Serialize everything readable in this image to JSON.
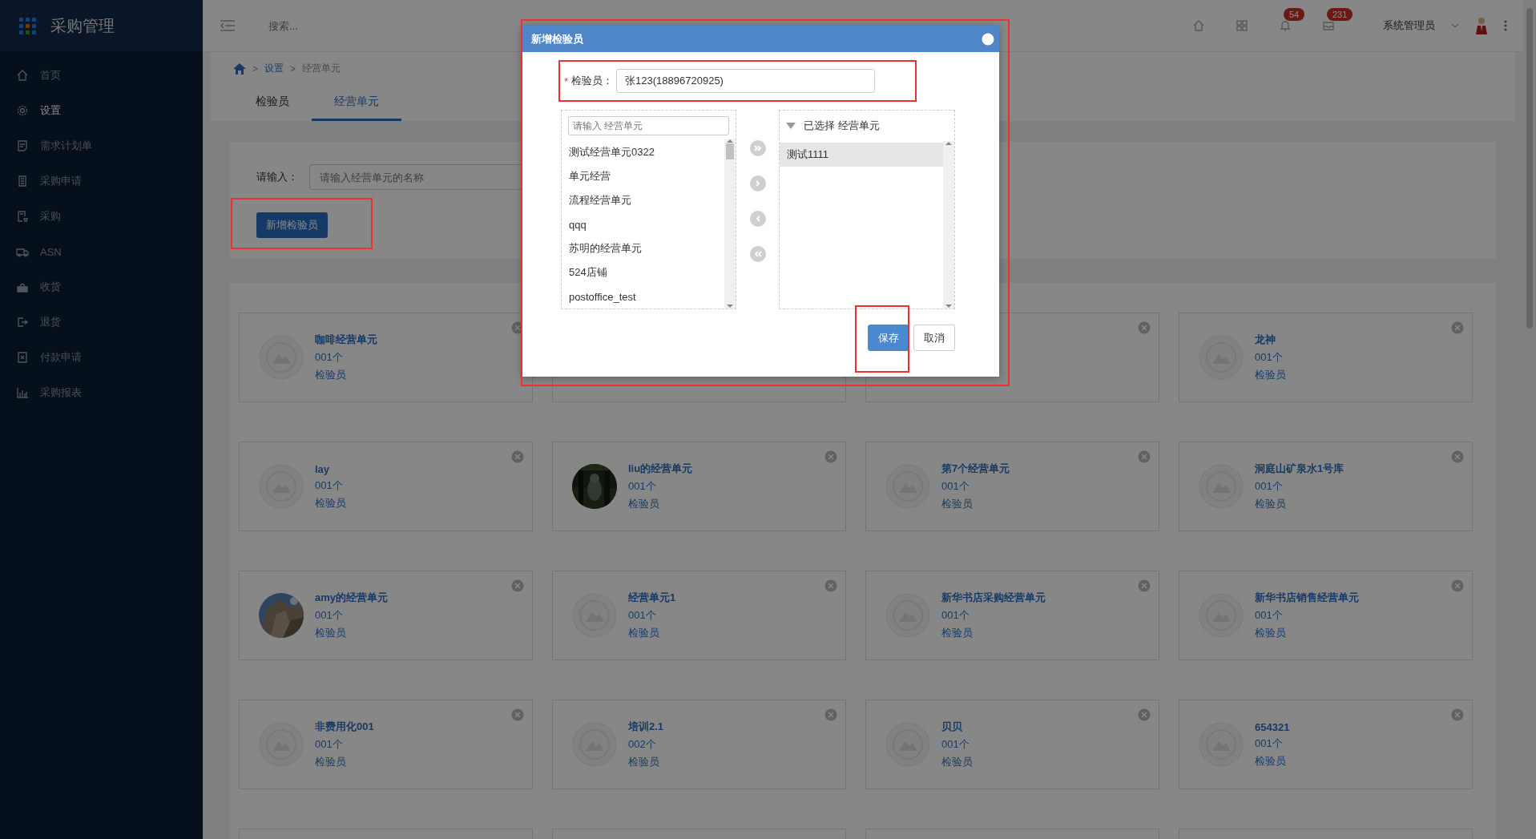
{
  "sidebar": {
    "title": "采购管理",
    "items": [
      {
        "label": "首页",
        "selected": false
      },
      {
        "label": "设置",
        "selected": true
      },
      {
        "label": "需求计划单",
        "selected": false
      },
      {
        "label": "采购申请",
        "selected": false
      },
      {
        "label": "采购",
        "selected": false
      },
      {
        "label": "ASN",
        "selected": false
      },
      {
        "label": "收货",
        "selected": false
      },
      {
        "label": "退货",
        "selected": false
      },
      {
        "label": "付款申请",
        "selected": false
      },
      {
        "label": "采购报表",
        "selected": false
      }
    ]
  },
  "topbar": {
    "search": {
      "placeholder": "搜索..."
    },
    "notifications": {
      "badge": "54"
    },
    "messages": {
      "badge": "231"
    },
    "user": {
      "name": "系统管理员"
    }
  },
  "breadcrumb": [
    {
      "kind": "home"
    },
    {
      "kind": "separator",
      "text": ">"
    },
    {
      "kind": "link",
      "text": "设置"
    },
    {
      "kind": "separator",
      "text": ">"
    },
    {
      "kind": "current",
      "text": "经营单元"
    }
  ],
  "tabs": [
    {
      "label": "检验员",
      "selected": false
    },
    {
      "label": "经营单元",
      "selected": true
    }
  ],
  "filter": {
    "label": "请输入：",
    "placeholder": "请输入经营单元的名称"
  },
  "add_button": "新增检验员",
  "cards": [
    {
      "name": "咖啡经营单元",
      "count": "001个",
      "role": "检验员",
      "kind": "placeholder",
      "closable": true
    },
    {
      "kind": "covered"
    },
    {
      "closable": true
    },
    {
      "name": "龙神",
      "count": "001个",
      "role": "检验员",
      "kind": "placeholder",
      "closable": true
    },
    {
      "name": "lay",
      "count": "001个",
      "role": "检验员",
      "kind": "placeholder",
      "closable": true
    },
    {
      "name": "liu的经营单元",
      "count": "001个",
      "role": "检验员",
      "closable": true
    },
    {
      "name": "第7个经营单元",
      "count": "001个",
      "role": "检验员",
      "kind": "placeholder",
      "closable": true
    },
    {
      "name": "洞庭山矿泉水1号库",
      "count": "001个",
      "role": "检验员",
      "kind": "placeholder",
      "closable": true
    },
    {
      "name": "amy的经营单元",
      "count": "001个",
      "role": "检验员",
      "closable": true
    },
    {
      "name": "经营单元1",
      "count": "001个",
      "role": "检验员",
      "kind": "placeholder",
      "closable": true
    },
    {
      "name": "新华书店采购经营单元",
      "count": "001个",
      "role": "检验员",
      "kind": "placeholder",
      "closable": true
    },
    {
      "name": "新华书店销售经营单元",
      "count": "001个",
      "role": "检验员",
      "kind": "placeholder",
      "closable": true
    },
    {
      "name": "非费用化001",
      "count": "001个",
      "role": "检验员",
      "kind": "placeholder",
      "closable": true
    },
    {
      "name": "培训2.1",
      "count": "002个",
      "role": "检验员",
      "kind": "placeholder",
      "closable": true
    },
    {
      "name": "贝贝",
      "count": "001个",
      "role": "检验员",
      "kind": "placeholder",
      "closable": true
    },
    {
      "name": "654321",
      "count": "001个",
      "role": "检验员",
      "kind": "placeholder",
      "closable": true
    },
    {
      "closable": false
    },
    {
      "closable": false
    },
    {
      "closable": false
    },
    {
      "closable": false
    }
  ],
  "dialog": {
    "title": "新增检验员",
    "field": {
      "required_mark": "*",
      "label": "检验员：",
      "value": "张123(18896720925)"
    },
    "available": {
      "placeholder": "请输入 经营单元",
      "items": [
        "测试经营单元0322",
        "单元经营",
        "流程经营单元",
        "qqq",
        "苏明的经营单元",
        "524店铺",
        "postoffice_test"
      ]
    },
    "chosen": {
      "title": "已选择 经营单元",
      "items": [
        {
          "label": "测试1111",
          "selected": true
        }
      ]
    },
    "buttons": [
      {
        "label": "保存",
        "kind": "primary"
      },
      {
        "label": "取消",
        "kind": "default"
      }
    ]
  }
}
